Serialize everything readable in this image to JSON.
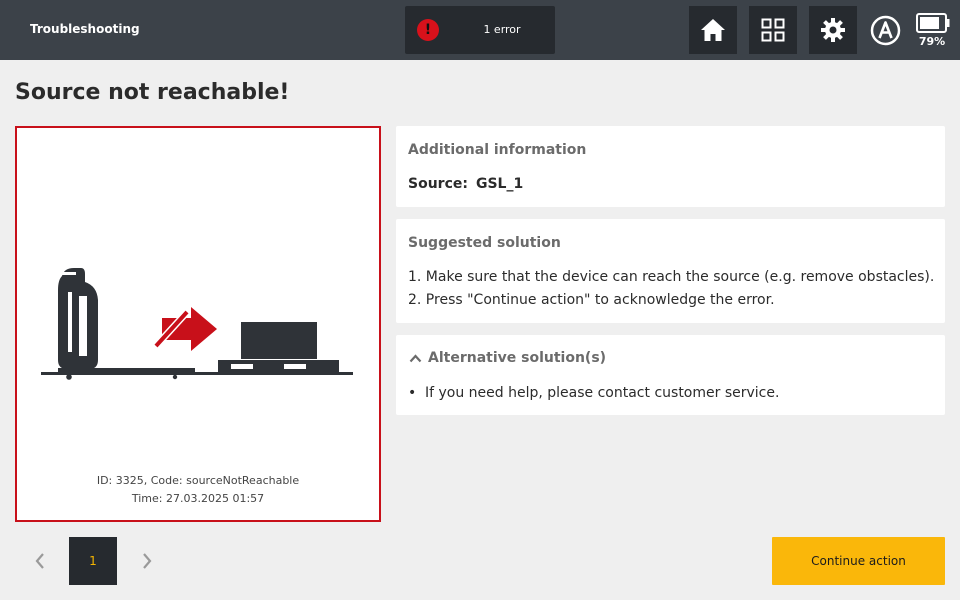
{
  "header": {
    "title": "Troubleshooting",
    "error_icon_glyph": "!",
    "error_label": "1 error",
    "battery_percent": "79%",
    "icons": [
      "home-icon",
      "grid-icon",
      "gear-icon",
      "auto-mode-icon",
      "battery-icon"
    ]
  },
  "page": {
    "title": "Source not reachable!"
  },
  "error_image": {
    "id_code": "ID: 3325, Code: sourceNotReachable",
    "time": "Time: 27.03.2025 01:57"
  },
  "additional_info": {
    "heading": "Additional information",
    "source_label": "Source:",
    "source_value": "GSL_1"
  },
  "suggested_solution": {
    "heading": "Suggested solution",
    "steps": [
      "1. Make sure that the device can reach the source (e.g. remove obstacles).",
      "2. Press \"Continue action\" to acknowledge the error."
    ]
  },
  "alternative_solution": {
    "heading": "Alternative solution(s)",
    "bullet": "•",
    "items": [
      "If you need help, please contact customer service."
    ]
  },
  "pager": {
    "current_page": "1"
  },
  "actions": {
    "continue_label": "Continue action"
  },
  "colors": {
    "topbar": "#3c4249",
    "button_dark": "#262a2f",
    "error_red": "#d8111b",
    "accent_yellow": "#fab70a",
    "border_red": "#c8101a"
  }
}
